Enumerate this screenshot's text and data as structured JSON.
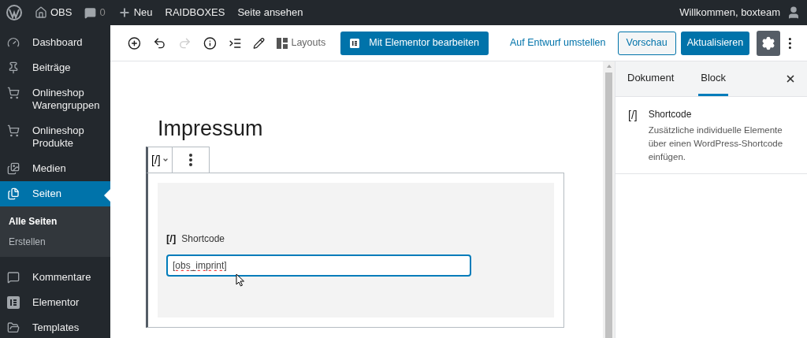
{
  "admin_bar": {
    "site": "OBS",
    "comments": "0",
    "new": "Neu",
    "links": [
      "RAIDBOXES",
      "Seite ansehen"
    ],
    "greeting": "Willkommen, boxteam"
  },
  "menu": [
    {
      "label": "Dashboard",
      "selected": false
    },
    {
      "label": "Beiträge",
      "selected": false
    },
    {
      "label": "Onlineshop Warengruppen",
      "selected": false
    },
    {
      "label": "Onlineshop Produkte",
      "selected": false
    },
    {
      "label": "Medien",
      "selected": false
    },
    {
      "label": "Seiten",
      "selected": true,
      "children": [
        {
          "label": "Alle Seiten",
          "selected": true
        },
        {
          "label": "Erstellen",
          "selected": false
        }
      ]
    },
    {
      "label": "Kommentare",
      "selected": false
    },
    {
      "label": "Elementor",
      "selected": false
    },
    {
      "label": "Templates",
      "selected": false
    }
  ],
  "toolbar": {
    "layouts": "Layouts",
    "elementor": "Mit Elementor bearbeiten",
    "draft": "Auf Entwurf umstellen",
    "preview": "Vorschau",
    "update": "Aktualisieren",
    "settings_on": true
  },
  "editor": {
    "title": "Impressum",
    "block_icon": "[/]",
    "block_label": "Shortcode",
    "value": "[obs_imprint]"
  },
  "panel": {
    "tabs": [
      {
        "label": "Dokument",
        "selected": false
      },
      {
        "label": "Block",
        "selected": true
      }
    ],
    "icon": "[/]",
    "name": "Shortcode",
    "description": "Zusätzliche individuelle Elemente über einen WordPress-Shortcode einfügen."
  }
}
